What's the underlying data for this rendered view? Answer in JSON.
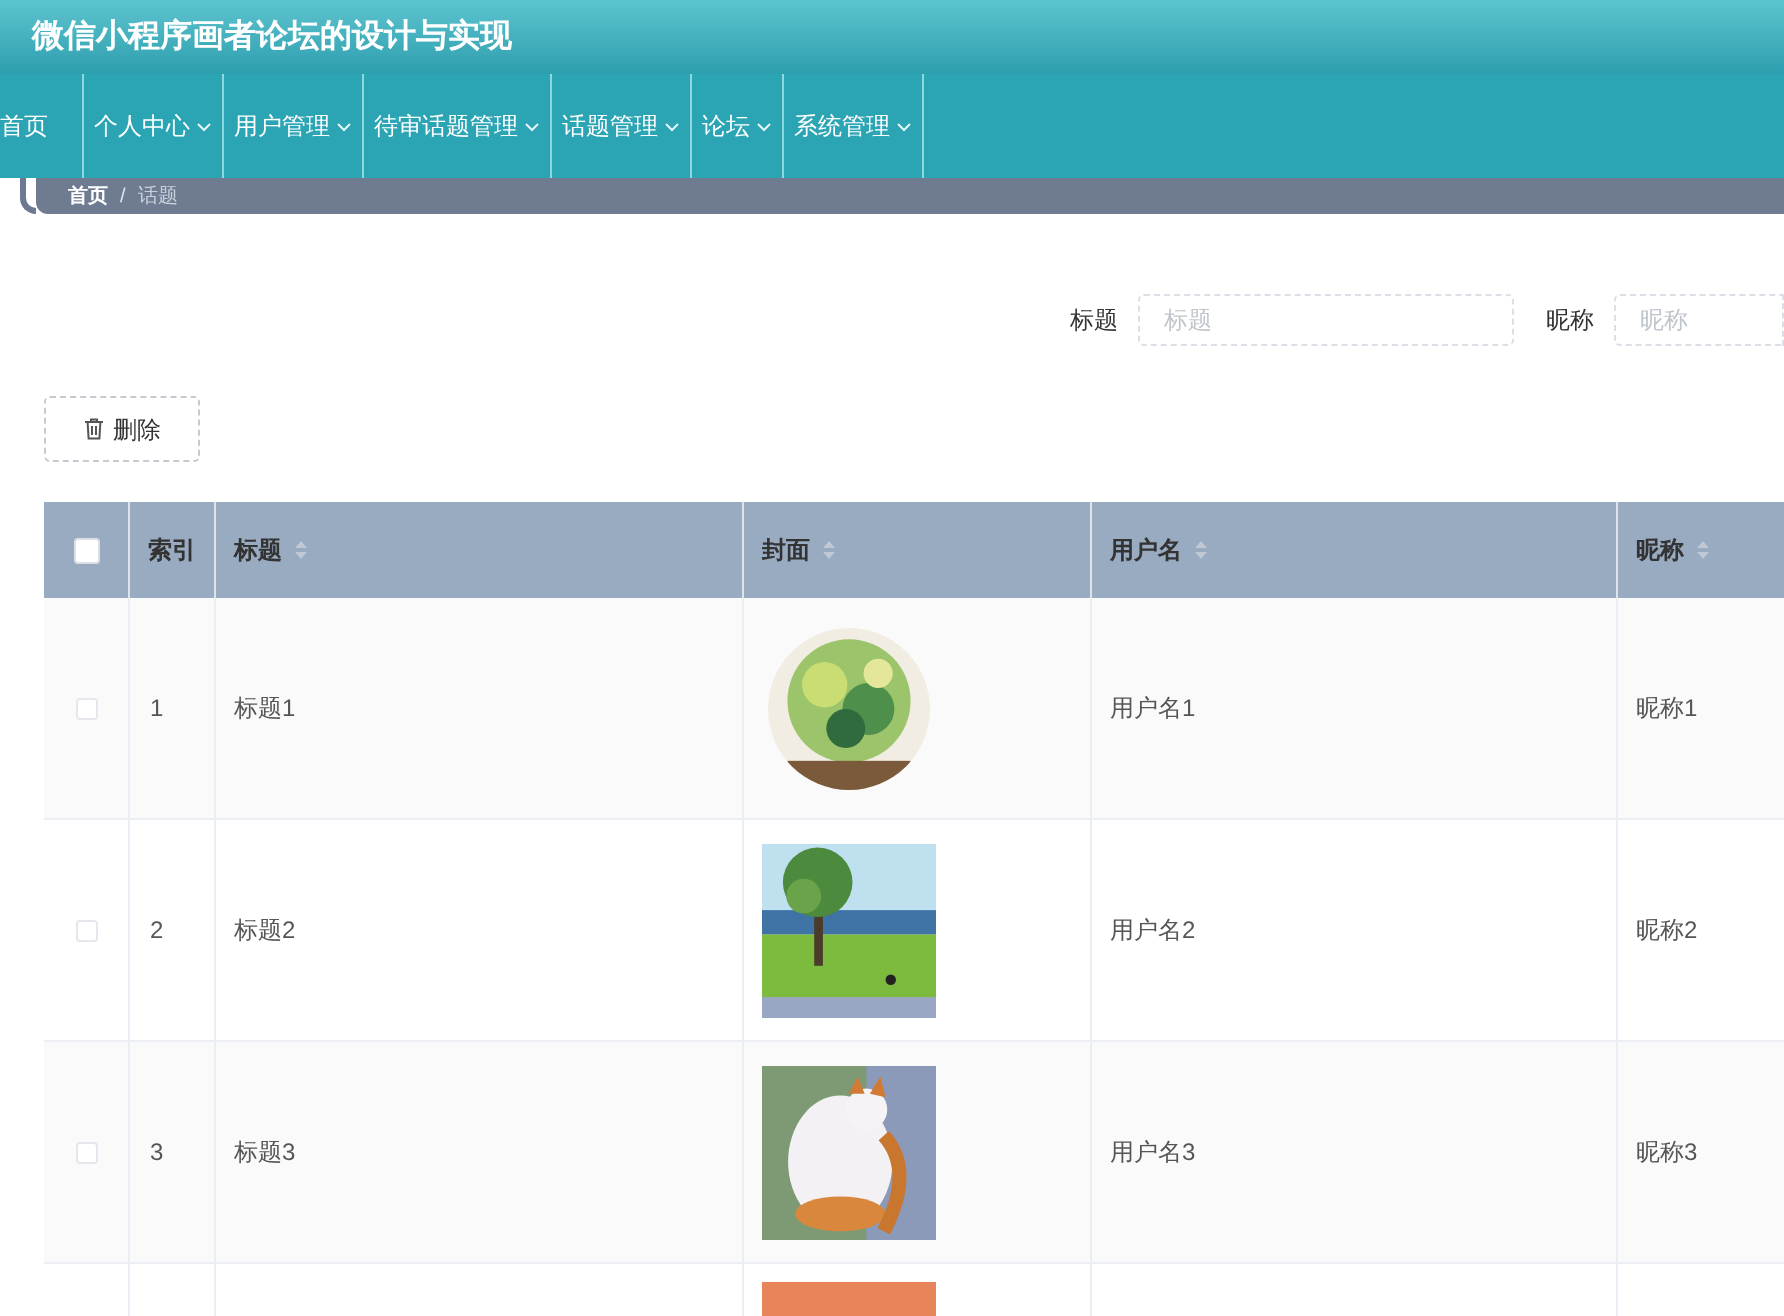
{
  "header": {
    "title": "微信小程序画者论坛的设计与实现"
  },
  "nav": [
    {
      "label": "首页",
      "dropdown": false
    },
    {
      "label": "个人中心",
      "dropdown": true
    },
    {
      "label": "用户管理",
      "dropdown": true
    },
    {
      "label": "待审话题管理",
      "dropdown": true
    },
    {
      "label": "话题管理",
      "dropdown": true
    },
    {
      "label": "论坛",
      "dropdown": true
    },
    {
      "label": "系统管理",
      "dropdown": true
    }
  ],
  "breadcrumb": {
    "items": [
      "首页",
      "话题"
    ],
    "separator": "/"
  },
  "search": [
    {
      "label": "标题",
      "placeholder": "标题"
    },
    {
      "label": "昵称",
      "placeholder": "昵称"
    }
  ],
  "delete_button": "删除",
  "table": {
    "select_all": {
      "checked": false
    },
    "columns": [
      {
        "label": "索引",
        "sortable": false
      },
      {
        "label": "标题",
        "sortable": true
      },
      {
        "label": "封面",
        "sortable": true
      },
      {
        "label": "用户名",
        "sortable": true
      },
      {
        "label": "昵称",
        "sortable": true
      }
    ],
    "rows": [
      {
        "checked": false,
        "cells": [
          "1",
          "标题1",
          "",
          "用户名1",
          "昵称1"
        ],
        "cover": {
          "kind": "picture",
          "round": true
        }
      },
      {
        "checked": false,
        "cells": [
          "2",
          "标题2",
          "",
          "用户名2",
          "昵称2"
        ],
        "cover": {
          "kind": "picture",
          "round": false
        }
      },
      {
        "checked": false,
        "cells": [
          "3",
          "标题3",
          "",
          "用户名3",
          "昵称3"
        ],
        "cover": {
          "kind": "picture",
          "round": false
        }
      },
      {
        "cells": [],
        "cover": {
          "kind": "picture",
          "round": false
        }
      }
    ]
  }
}
